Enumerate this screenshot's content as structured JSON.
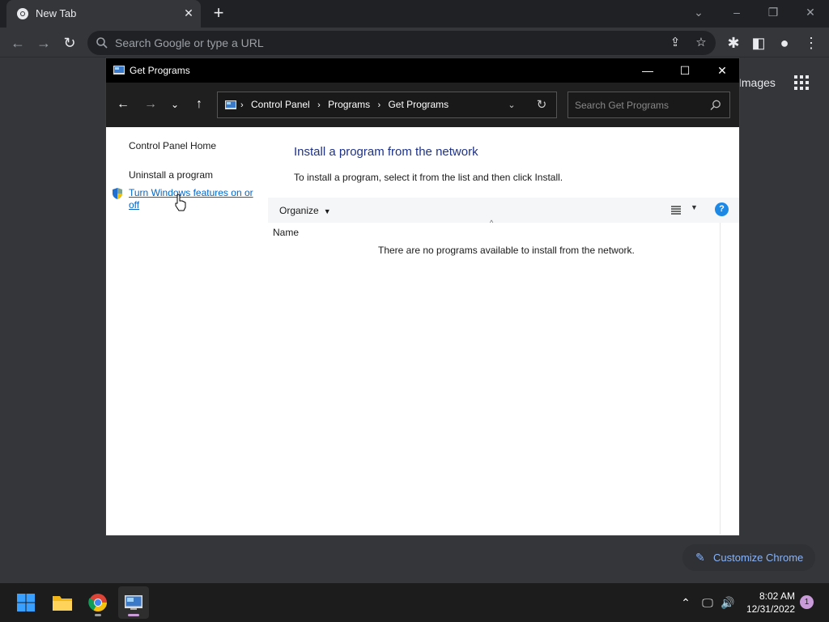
{
  "browser": {
    "tab_title": "New Tab",
    "omnibox_placeholder": "Search Google or type a URL",
    "ntp_images_label": "Images",
    "customize_label": "Customize Chrome"
  },
  "window": {
    "title": "Get Programs",
    "breadcrumbs": [
      "Control Panel",
      "Programs",
      "Get Programs"
    ],
    "search_placeholder": "Search Get Programs",
    "sidebar": {
      "home": "Control Panel Home",
      "uninstall": "Uninstall a program",
      "features": "Turn Windows features on or off"
    },
    "heading": "Install a program from the network",
    "description": "To install a program, select it from the list and then click Install.",
    "organize_label": "Organize",
    "column_name": "Name",
    "empty_message": "There are no programs available to install from the network."
  },
  "taskbar": {
    "time": "8:02 AM",
    "date": "12/31/2022",
    "notification_count": "1"
  },
  "colors": {
    "chrome_dark": "#202124",
    "heading_blue": "#1e3287",
    "link_blue": "#0066cc",
    "accent_purple": "#c99bd8"
  },
  "icons": [
    "chrome-icon",
    "close-icon",
    "plus-icon",
    "back-icon",
    "forward-icon",
    "reload-icon",
    "search-icon",
    "share-icon",
    "star-icon",
    "extensions-icon",
    "sidepanel-icon",
    "profile-icon",
    "menu-icon",
    "apps-grid-icon",
    "pencil-icon",
    "control-panel-icon",
    "shield-icon",
    "chevron-down-icon",
    "up-arrow-icon",
    "refresh-icon",
    "view-list-icon",
    "help-icon",
    "windows-start-icon",
    "file-explorer-icon",
    "speaker-icon",
    "network-icon",
    "chevron-up-icon"
  ]
}
